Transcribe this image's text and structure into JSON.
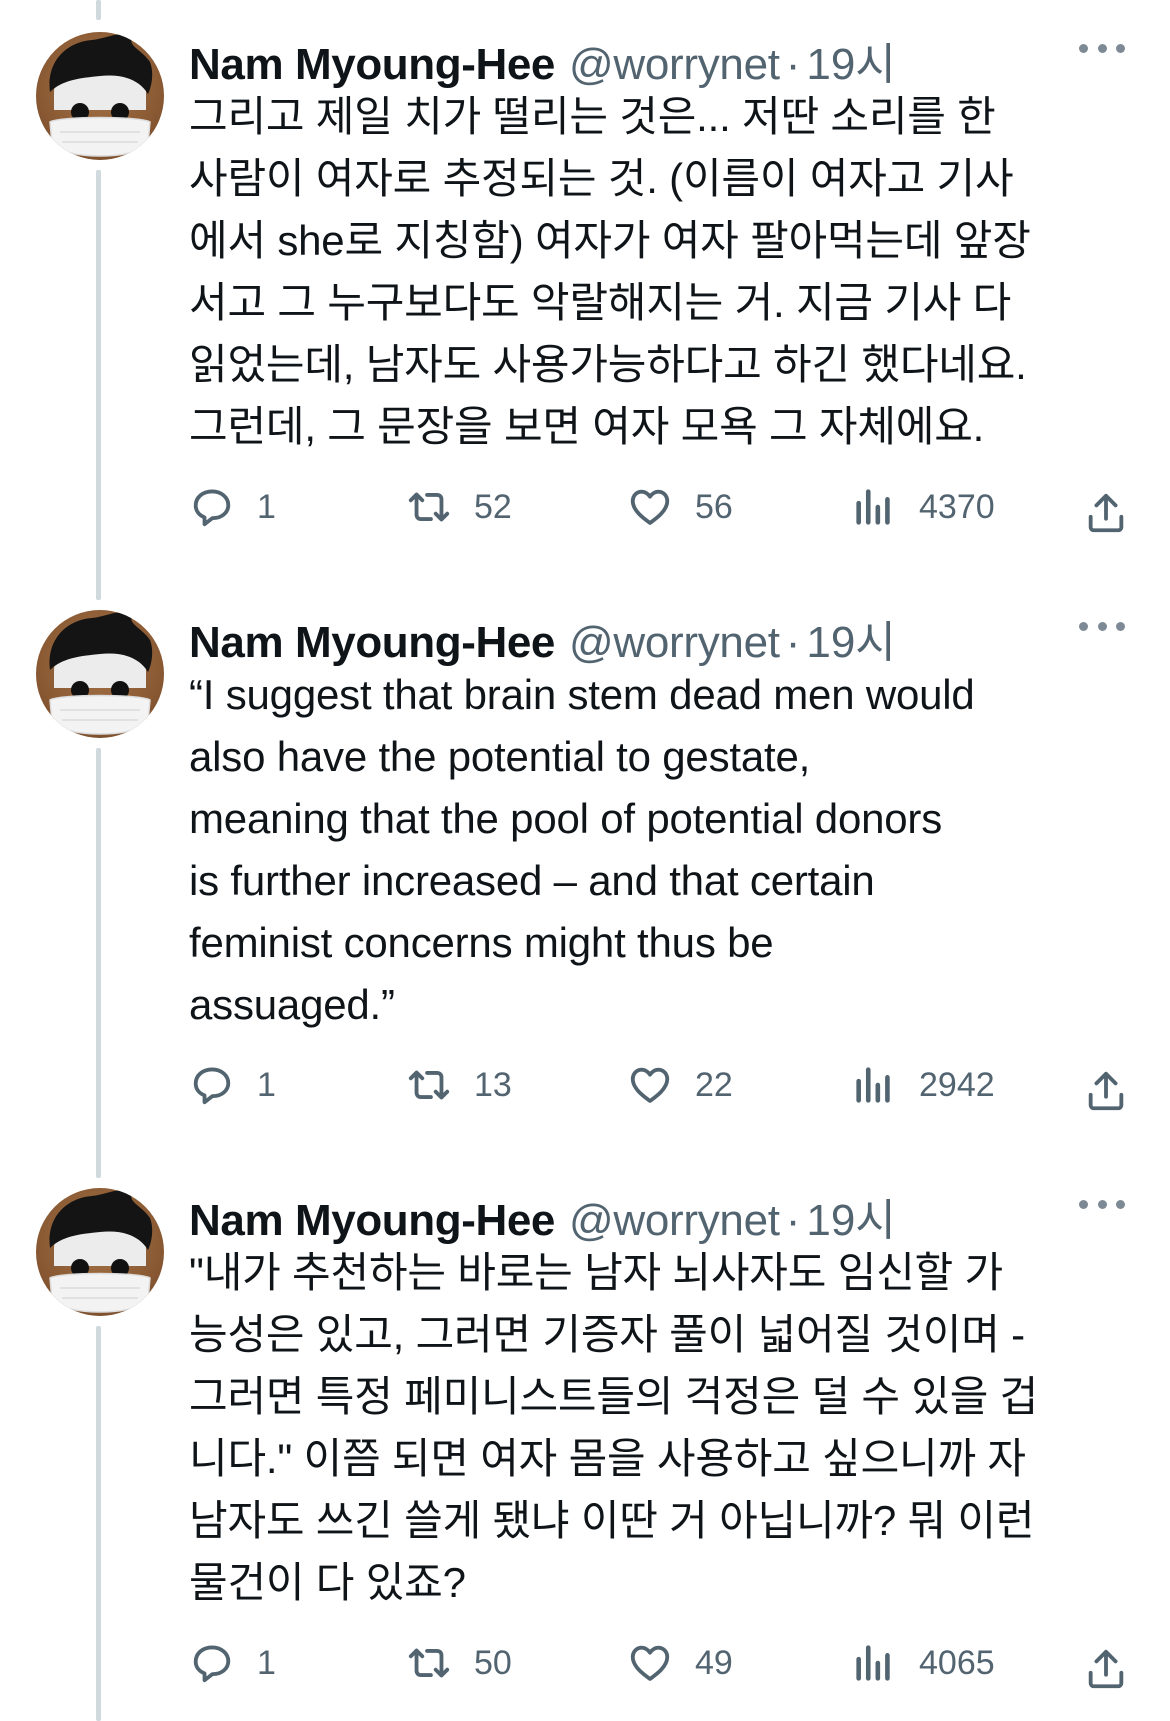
{
  "tweets": [
    {
      "author": "Nam Myoung-Hee",
      "handle": "@worrynet",
      "separator": "·",
      "time": "19시",
      "text": "그리고 제일 치가 떨리는 것은... 저딴 소리를 한\n사람이 여자로 추정되는 것. (이름이 여자고 기사\n에서 she로 지칭함) 여자가 여자 팔아먹는데 앞장\n서고 그 누구보다도 악랄해지는 거. 지금 기사 다\n읽었는데, 남자도 사용가능하다고 하긴 했다네요.\n그런데, 그 문장을 보면 여자 모욕 그 자체에요.",
      "replies": "1",
      "retweets": "52",
      "likes": "56",
      "views": "4370"
    },
    {
      "author": "Nam Myoung-Hee",
      "handle": "@worrynet",
      "separator": "·",
      "time": "19시",
      "text": "“I suggest that brain stem dead men would\nalso have the potential to gestate,\nmeaning that the pool of potential donors\nis further increased – and that certain\nfeminist concerns might thus be\nassuaged.”",
      "replies": "1",
      "retweets": "13",
      "likes": "22",
      "views": "2942"
    },
    {
      "author": "Nam Myoung-Hee",
      "handle": "@worrynet",
      "separator": "·",
      "time": "19시",
      "text": "\"내가 추천하는 바로는 남자 뇌사자도 임신할 가\n능성은 있고, 그러면 기증자 풀이 넓어질 것이며 -\n그러면 특정 페미니스트들의 걱정은 덜 수 있을 겁\n니다.\" 이쯤 되면 여자 몸을 사용하고 싶으니까 자\n남자도 쓰긴 쓸게 됐냐 이딴 거 아닙니까? 뭐 이런\n물건이 다 있죠?",
      "replies": "1",
      "retweets": "50",
      "likes": "49",
      "views": "4065"
    }
  ],
  "colors": {
    "text": "#0f1419",
    "secondary": "#536471",
    "thread_line": "#cfd9de",
    "background": "#ffffff"
  },
  "icons": [
    "avatar-image",
    "more-icon",
    "reply-icon",
    "retweet-icon",
    "like-icon",
    "views-icon",
    "share-icon"
  ]
}
